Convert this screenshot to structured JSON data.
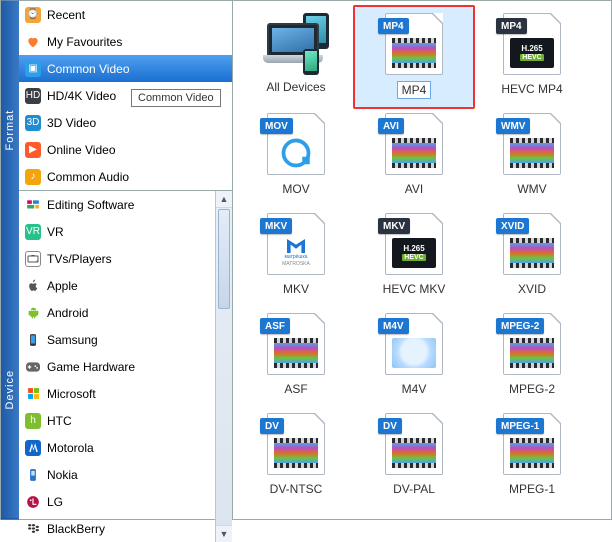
{
  "sidebar": {
    "vertical_tabs": [
      "Format",
      "Device"
    ],
    "format_items": [
      {
        "label": "Recent",
        "icon": "recent-icon"
      },
      {
        "label": "My Favourites",
        "icon": "heart-icon"
      },
      {
        "label": "Common Video",
        "icon": "common-video-icon",
        "selected": true
      },
      {
        "label": "HD/4K Video",
        "icon": "hd-icon"
      },
      {
        "label": "3D Video",
        "icon": "3d-icon"
      },
      {
        "label": "Online Video",
        "icon": "online-icon"
      },
      {
        "label": "Common Audio",
        "icon": "audio-icon"
      }
    ],
    "device_items": [
      {
        "label": "Editing Software",
        "icon": "edit-icon"
      },
      {
        "label": "VR",
        "icon": "vr-icon"
      },
      {
        "label": "TVs/Players",
        "icon": "tv-icon"
      },
      {
        "label": "Apple",
        "icon": "apple-icon"
      },
      {
        "label": "Android",
        "icon": "android-icon"
      },
      {
        "label": "Samsung",
        "icon": "samsung-icon"
      },
      {
        "label": "Game Hardware",
        "icon": "gamepad-icon"
      },
      {
        "label": "Microsoft",
        "icon": "microsoft-icon"
      },
      {
        "label": "HTC",
        "icon": "htc-icon"
      },
      {
        "label": "Motorola",
        "icon": "motorola-icon"
      },
      {
        "label": "Nokia",
        "icon": "nokia-icon"
      },
      {
        "label": "LG",
        "icon": "lg-icon"
      },
      {
        "label": "BlackBerry",
        "icon": "blackberry-icon"
      }
    ],
    "tooltip": "Common Video"
  },
  "grid": {
    "items": [
      {
        "label": "All Devices",
        "badge": "",
        "kind": "devices"
      },
      {
        "label": "MP4",
        "badge": "MP4",
        "kind": "film",
        "highlighted": true,
        "selected": true
      },
      {
        "label": "HEVC MP4",
        "badge": "MP4",
        "kind": "h265",
        "badge_style": "dark"
      },
      {
        "label": "MOV",
        "badge": "MOV",
        "kind": "mov"
      },
      {
        "label": "AVI",
        "badge": "AVI",
        "kind": "film"
      },
      {
        "label": "WMV",
        "badge": "WMV",
        "kind": "film"
      },
      {
        "label": "MKV",
        "badge": "MKV",
        "kind": "matroska"
      },
      {
        "label": "HEVC MKV",
        "badge": "MKV",
        "kind": "h265",
        "badge_style": "dark"
      },
      {
        "label": "XVID",
        "badge": "XVID",
        "kind": "film"
      },
      {
        "label": "ASF",
        "badge": "ASF",
        "kind": "film"
      },
      {
        "label": "M4V",
        "badge": "M4V",
        "kind": "m4v"
      },
      {
        "label": "MPEG-2",
        "badge": "MPEG-2",
        "kind": "film"
      },
      {
        "label": "DV-NTSC",
        "badge": "DV",
        "kind": "film"
      },
      {
        "label": "DV-PAL",
        "badge": "DV",
        "kind": "film"
      },
      {
        "label": "MPEG-1",
        "badge": "MPEG-1",
        "kind": "film"
      }
    ]
  }
}
